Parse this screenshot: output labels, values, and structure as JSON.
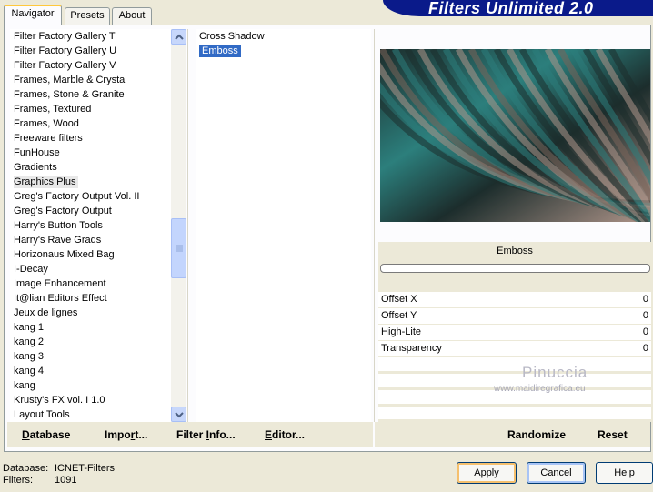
{
  "tabs": [
    {
      "label": "Navigator",
      "active": true
    },
    {
      "label": "Presets",
      "active": false
    },
    {
      "label": "About",
      "active": false
    }
  ],
  "banner": {
    "title": "Filters Unlimited 2.0",
    "color": "#0a1a8a"
  },
  "categories": {
    "items": [
      "Filter Factory Gallery T",
      "Filter Factory Gallery U",
      "Filter Factory Gallery V",
      "Frames, Marble & Crystal",
      "Frames, Stone & Granite",
      "Frames, Textured",
      "Frames, Wood",
      "Freeware filters",
      "FunHouse",
      "Gradients",
      "Graphics Plus",
      "Greg's Factory Output Vol. II",
      "Greg's Factory Output",
      "Harry's Button Tools",
      "Harry's Rave Grads",
      "Horizonaus Mixed Bag",
      "I-Decay",
      "Image Enhancement",
      "It@lian Editors Effect",
      "Jeux de lignes",
      "kang 1",
      "kang 2",
      "kang 3",
      "kang 4",
      "kang",
      "Krusty's FX vol. I 1.0",
      "Layout Tools"
    ],
    "selected": "Graphics Plus"
  },
  "filters": {
    "items": [
      "Cross Shadow",
      "Emboss"
    ],
    "selected": "Emboss",
    "selection_color": "#316ac5"
  },
  "preview": {
    "palette": [
      "#1d2d2c",
      "#2f8d8a",
      "#c9a79a",
      "#8d6e61"
    ]
  },
  "params": {
    "filter_name": "Emboss",
    "rows": [
      {
        "label": "Offset X",
        "value": "0"
      },
      {
        "label": "Offset Y",
        "value": "0"
      },
      {
        "label": "High-Lite",
        "value": "0"
      },
      {
        "label": "Transparency",
        "value": "0"
      }
    ]
  },
  "watermark": {
    "name": "Pinuccia",
    "url": "www.maidiregrafica.eu"
  },
  "toolbar": {
    "database": {
      "label": "Database",
      "underline": "D",
      "rest": "atabase"
    },
    "import": {
      "label": "Import...",
      "pre": "Impo",
      "underline": "r",
      "rest": "t..."
    },
    "filter_info": {
      "label": "Filter Info...",
      "pre": "Filter ",
      "underline": "I",
      "rest": "nfo..."
    },
    "editor": {
      "label": "Editor...",
      "underline": "E",
      "rest": "ditor..."
    },
    "randomize": "Randomize",
    "reset": "Reset"
  },
  "status": {
    "database_label": "Database:",
    "database_value": "ICNET-Filters",
    "filters_label": "Filters:",
    "filters_value": "1091"
  },
  "buttons": {
    "apply": "Apply",
    "cancel": "Cancel",
    "help": "Help"
  }
}
